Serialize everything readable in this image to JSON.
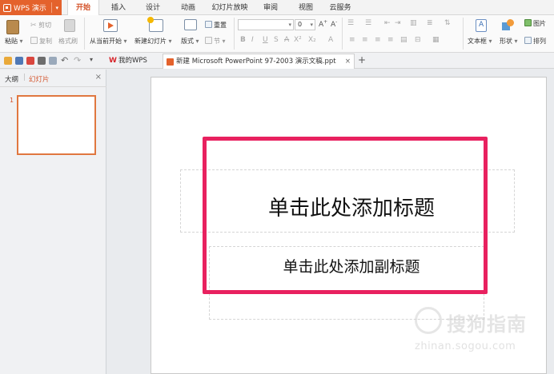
{
  "menubar": {
    "app_label": "WPS 演示",
    "tabs": [
      "开始",
      "插入",
      "设计",
      "动画",
      "幻灯片放映",
      "审阅",
      "视图",
      "云服务"
    ],
    "active_tab": "开始"
  },
  "ribbon": {
    "paste": "粘贴",
    "cut": "剪切",
    "copy": "复制",
    "format_painter": "格式刷",
    "play_from_current": "从当前开始",
    "new_slide": "新建幻灯片",
    "layout": "版式",
    "reset": "重置",
    "section": "节",
    "font_size": "0",
    "textbox": "文本框",
    "shape": "形状",
    "picture": "图片",
    "arrange": "排列"
  },
  "doc_tabs": {
    "my_wps": "我的WPS",
    "document": "新建 Microsoft PowerPoint 97-2003 演示文稿.ppt",
    "close": "×",
    "add": "+"
  },
  "left_panel": {
    "outline_tab": "大纲",
    "slides_tab": "幻灯片",
    "close": "×",
    "slide_number": "1"
  },
  "slide": {
    "title_placeholder": "单击此处添加标题",
    "subtitle_placeholder": "单击此处添加副标题"
  },
  "watermark": {
    "brand": "搜狗指南",
    "url": "zhinan.sogou.com"
  },
  "colors": {
    "accent": "#e4622c",
    "active_tab_text": "#d4532a",
    "highlight_box": "#e8215f"
  }
}
